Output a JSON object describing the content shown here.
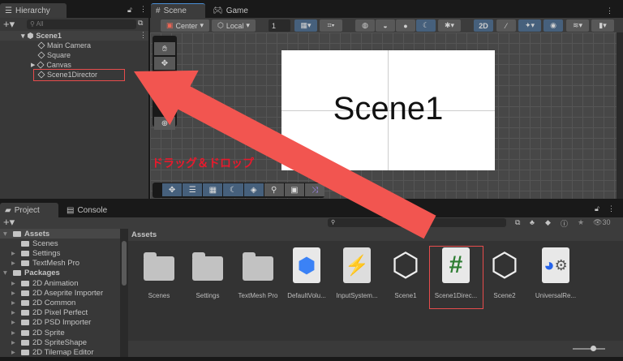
{
  "hierarchy": {
    "tab": "Hierarchy",
    "search_placeholder": "All",
    "scene": "Scene1",
    "items": [
      "Main Camera",
      "Square",
      "Canvas",
      "Scene1Director"
    ]
  },
  "scene_tabs": [
    "Scene",
    "Game"
  ],
  "scene_toolbar": {
    "pivot": "Center",
    "space": "Local",
    "grid_value": "1",
    "mode_2d": "2D"
  },
  "scene_view": {
    "text": "Scene1",
    "annotation": "ドラッグ＆ドロップ"
  },
  "project": {
    "tabs": [
      "Project",
      "Console"
    ],
    "tree": [
      {
        "label": "Assets",
        "level": 0,
        "bold": true
      },
      {
        "label": "Scenes",
        "level": 1
      },
      {
        "label": "Settings",
        "level": 1
      },
      {
        "label": "TextMesh Pro",
        "level": 1
      },
      {
        "label": "Packages",
        "level": 0,
        "bold": true
      },
      {
        "label": "2D Animation",
        "level": 1
      },
      {
        "label": "2D Aseprite Importer",
        "level": 1
      },
      {
        "label": "2D Common",
        "level": 1
      },
      {
        "label": "2D Pixel Perfect",
        "level": 1
      },
      {
        "label": "2D PSD Importer",
        "level": 1
      },
      {
        "label": "2D Sprite",
        "level": 1
      },
      {
        "label": "2D SpriteShape",
        "level": 1
      },
      {
        "label": "2D Tilemap Editor",
        "level": 1
      }
    ],
    "breadcrumb": "Assets",
    "hidden_count": "30",
    "assets": [
      {
        "label": "Scenes",
        "icon": "folder"
      },
      {
        "label": "Settings",
        "icon": "folder"
      },
      {
        "label": "TextMesh Pro",
        "icon": "folder"
      },
      {
        "label": "DefaultVolu...",
        "icon": "volume-profile"
      },
      {
        "label": "InputSystem...",
        "icon": "input-actions"
      },
      {
        "label": "Scene1",
        "icon": "unity-scene"
      },
      {
        "label": "Scene1Direc...",
        "icon": "csharp-script"
      },
      {
        "label": "Scene2",
        "icon": "unity-scene"
      },
      {
        "label": "UniversalRe...",
        "icon": "render-pipeline-asset"
      }
    ]
  },
  "colors": {
    "highlight": "#e74c4c",
    "arrow": "#f25550",
    "annotation": "#e8192c",
    "script_hash": "#2e7d32",
    "active_button": "#46607c"
  }
}
